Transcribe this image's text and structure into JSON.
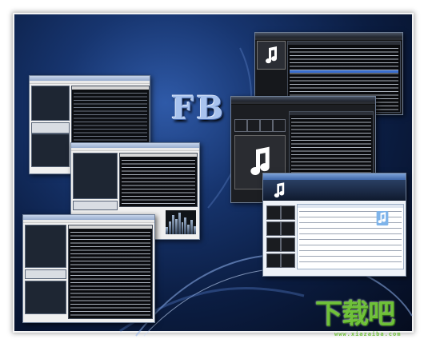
{
  "scene": {
    "logo_text": "FB",
    "watermark_text": "下载吧",
    "watermark_url": "www.xiazaiba.com",
    "background_colors": [
      "#2f5aa8",
      "#0b1d42",
      "#050c1e"
    ],
    "accent": "#6fc13a"
  },
  "windows": [
    {
      "id": "w1",
      "style": "light",
      "layout": "panes-left-list-right"
    },
    {
      "id": "w2",
      "style": "light",
      "layout": "panes-left-list-right-eq"
    },
    {
      "id": "w3",
      "style": "light",
      "layout": "panes-left-list-right"
    },
    {
      "id": "w4",
      "style": "dark",
      "layout": "art-left-list-right"
    },
    {
      "id": "w5",
      "style": "dark",
      "layout": "tiles-left-list-right"
    },
    {
      "id": "w6",
      "style": "light-blue",
      "layout": "tiles-left-list-right"
    }
  ],
  "icons": [
    "music-note-icon"
  ]
}
